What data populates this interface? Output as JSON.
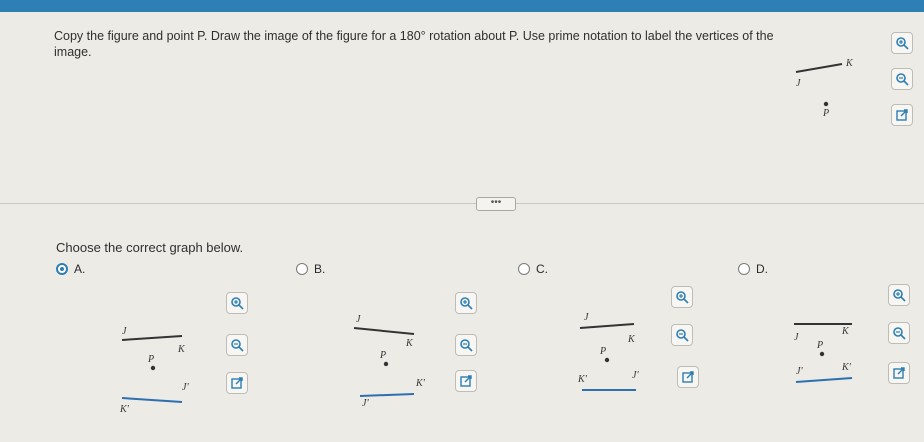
{
  "question": {
    "text": "Copy the figure and point P. Draw the image of the figure for a 180° rotation about P. Use prime notation to label the vertices of the image."
  },
  "prompt": "Choose the correct graph below.",
  "more_button": "•••",
  "options": [
    {
      "id": "A",
      "label": "A.",
      "selected": true
    },
    {
      "id": "B",
      "label": "B.",
      "selected": false
    },
    {
      "id": "C",
      "label": "C.",
      "selected": false
    },
    {
      "id": "D",
      "label": "D.",
      "selected": false
    }
  ],
  "labels": {
    "J": "J",
    "K": "K",
    "P": "P",
    "Jp": "J'",
    "Kp": "K'"
  },
  "icons": {
    "zoom_in": "zoom-in-icon",
    "zoom_out": "zoom-out-icon",
    "popout": "popout-icon"
  }
}
